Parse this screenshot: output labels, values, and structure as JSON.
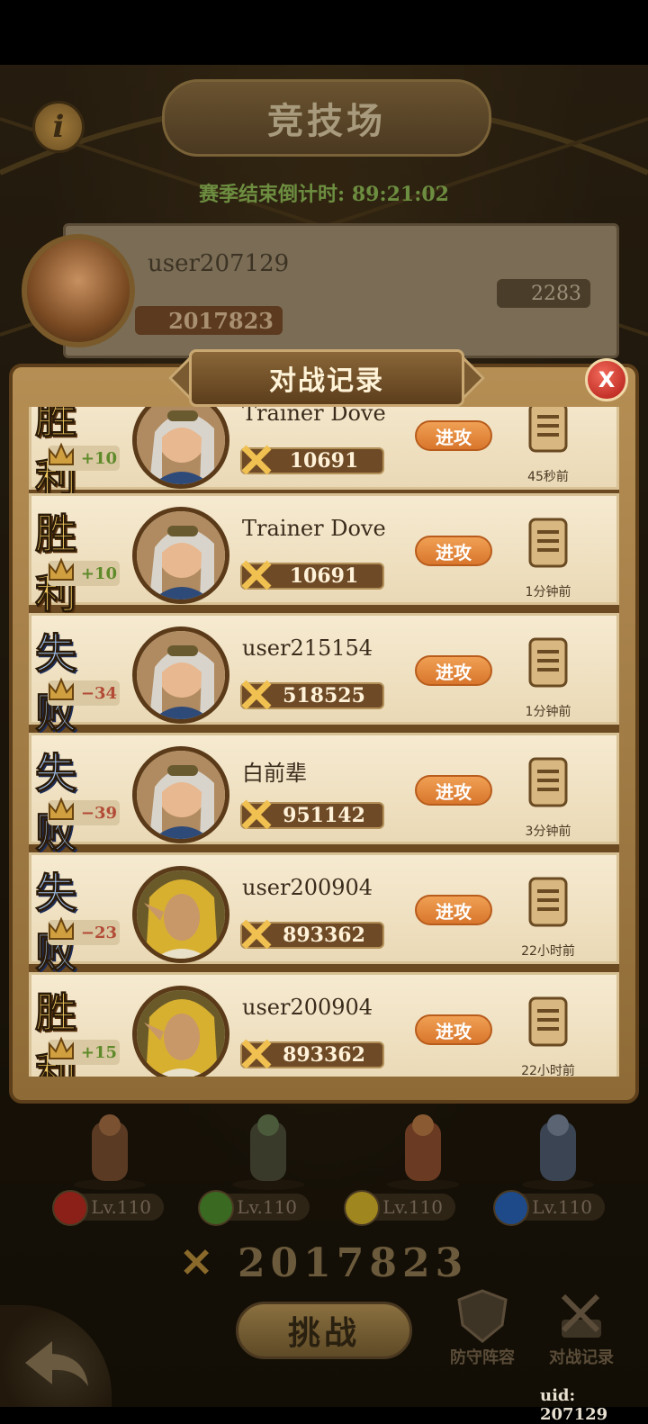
{
  "header": {
    "title": "竞技场",
    "info_label": "i",
    "countdown_label": "赛季结束倒计时:",
    "countdown_value": "89:21:02"
  },
  "player": {
    "name": "user207129",
    "power": "2017823",
    "trophies": "2283"
  },
  "modal": {
    "title": "对战记录",
    "close_label": "X",
    "attack_label": "进攻",
    "rows": [
      {
        "result": "胜 利",
        "outcome": "win",
        "delta": "+10",
        "name": "Trainer Dove",
        "power": "10691",
        "time": "45秒前",
        "avatar": "goggles-hero"
      },
      {
        "result": "胜 利",
        "outcome": "win",
        "delta": "+10",
        "name": "Trainer Dove",
        "power": "10691",
        "time": "1分钟前",
        "avatar": "goggles-hero"
      },
      {
        "result": "失 败",
        "outcome": "lose",
        "delta": "−34",
        "name": "user215154",
        "power": "518525",
        "time": "1分钟前",
        "avatar": "goggles-hero"
      },
      {
        "result": "失 败",
        "outcome": "lose",
        "delta": "−39",
        "name": "白前辈",
        "power": "951142",
        "time": "3分钟前",
        "avatar": "goggles-hero"
      },
      {
        "result": "失 败",
        "outcome": "lose",
        "delta": "−23",
        "name": "user200904",
        "power": "893362",
        "time": "22小时前",
        "avatar": "hooded-elf-hero"
      },
      {
        "result": "胜 利",
        "outcome": "win",
        "delta": "+15",
        "name": "user200904",
        "power": "893362",
        "time": "22小时前",
        "avatar": "hooded-elf-hero"
      }
    ]
  },
  "team": {
    "heroes": [
      {
        "level": "Lv.110",
        "element": "fire",
        "color": "#8a2018"
      },
      {
        "level": "Lv.110",
        "element": "nature",
        "color": "#3a6a22"
      },
      {
        "level": "Lv.110",
        "element": "earth",
        "color": "#a0861e"
      },
      {
        "level": "Lv.110",
        "element": "water",
        "color": "#1e4a8a"
      }
    ],
    "power": "2017823"
  },
  "bottom": {
    "challenge_label": "挑战",
    "defense_label": "防守阵容",
    "records_label": "对战记录",
    "uid": "uid: 207129"
  },
  "colors": {
    "win_text": "#f0c860",
    "lose_text": "#9fc2f0",
    "attack_button": "#e88a3c",
    "close_button": "#d02a20"
  }
}
